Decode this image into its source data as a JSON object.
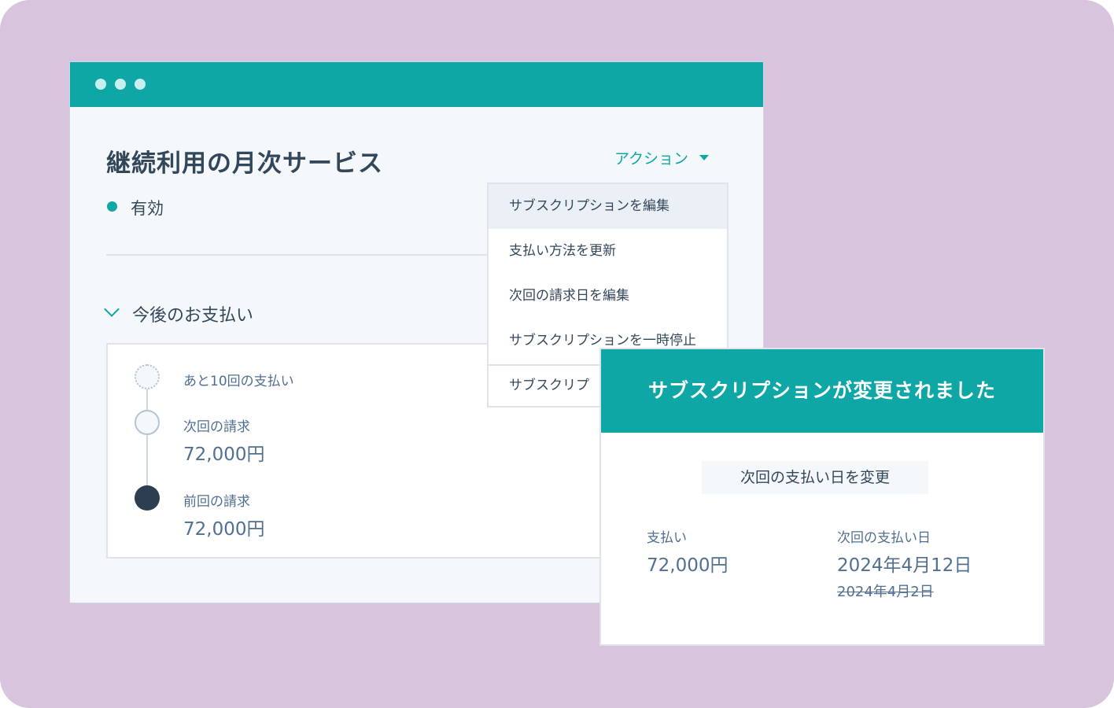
{
  "window": {
    "title": "継続利用の月次サービス",
    "actions_label": "アクション",
    "status": "有効",
    "section_title": "今後のお支払い"
  },
  "timeline": [
    {
      "label": "あと10回の支払い",
      "amount": ""
    },
    {
      "label": "次回の請求",
      "amount": "72,000円"
    },
    {
      "label": "前回の請求",
      "amount": "72,000円"
    }
  ],
  "dropdown": {
    "items": [
      "サブスクリプションを編集",
      "支払い方法を更新",
      "次回の請求日を編集",
      "サブスクリプションを一時停止",
      "サブスクリプ"
    ]
  },
  "notification": {
    "title": "サブスクリプションが変更されました",
    "tag": "次回の支払い日を変更",
    "payment_label": "支払い",
    "payment_value": "72,000円",
    "next_date_label": "次回の支払い日",
    "next_date_value": "2024年4月12日",
    "old_date_value": "2024年4月2日"
  },
  "colors": {
    "background": "#d8c4dc",
    "accent": "#0fa6a6",
    "text": "#33475b"
  },
  "icons": {
    "status": "status-dot-icon",
    "section_toggle": "chevron-down-icon",
    "actions": "caret-down-icon"
  }
}
